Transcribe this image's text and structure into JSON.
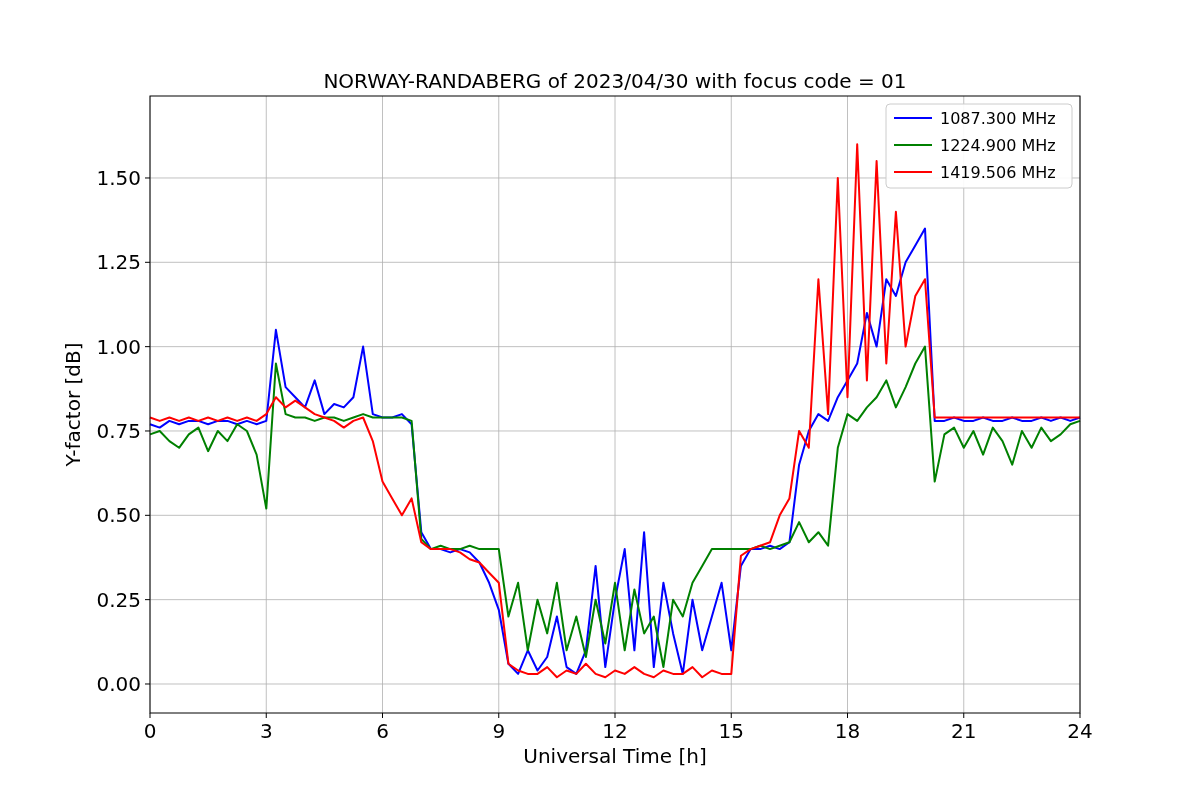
{
  "figure": {
    "chart_data": {
      "type": "line",
      "title": "NORWAY-RANDABERG of 2023/04/30 with focus code = 01",
      "xlabel": "Universal Time [h]",
      "ylabel": "Y-factor [dB]",
      "x": [
        0,
        0.25,
        0.5,
        0.75,
        1,
        1.25,
        1.5,
        1.75,
        2,
        2.25,
        2.5,
        2.75,
        3,
        3.25,
        3.5,
        3.75,
        4,
        4.25,
        4.5,
        4.75,
        5,
        5.25,
        5.5,
        5.75,
        6,
        6.25,
        6.5,
        6.75,
        7,
        7.25,
        7.5,
        7.75,
        8,
        8.25,
        8.5,
        8.75,
        9,
        9.25,
        9.5,
        9.75,
        10,
        10.25,
        10.5,
        10.75,
        11,
        11.25,
        11.5,
        11.75,
        12,
        12.25,
        12.5,
        12.75,
        13,
        13.25,
        13.5,
        13.75,
        14,
        14.25,
        14.5,
        14.75,
        15,
        15.25,
        15.5,
        15.75,
        16,
        16.25,
        16.5,
        16.75,
        17,
        17.25,
        17.5,
        17.75,
        18,
        18.25,
        18.5,
        18.75,
        19,
        19.25,
        19.5,
        19.75,
        20,
        20.25,
        20.5,
        20.75,
        21,
        21.25,
        21.5,
        21.75,
        22,
        22.25,
        22.5,
        22.75,
        23,
        23.25,
        23.5,
        23.75,
        24
      ],
      "series": [
        {
          "name": "1087.300 MHz",
          "color": "#0000ff",
          "values": [
            0.77,
            0.76,
            0.78,
            0.77,
            0.78,
            0.78,
            0.77,
            0.78,
            0.78,
            0.77,
            0.78,
            0.77,
            0.78,
            1.05,
            0.88,
            0.85,
            0.82,
            0.9,
            0.8,
            0.83,
            0.82,
            0.85,
            1.0,
            0.8,
            0.79,
            0.79,
            0.8,
            0.77,
            0.45,
            0.4,
            0.4,
            0.39,
            0.4,
            0.39,
            0.36,
            0.3,
            0.22,
            0.06,
            0.03,
            0.1,
            0.04,
            0.08,
            0.2,
            0.05,
            0.03,
            0.1,
            0.35,
            0.05,
            0.25,
            0.4,
            0.1,
            0.45,
            0.05,
            0.3,
            0.15,
            0.03,
            0.25,
            0.1,
            0.2,
            0.3,
            0.1,
            0.35,
            0.4,
            0.4,
            0.41,
            0.4,
            0.42,
            0.65,
            0.75,
            0.8,
            0.78,
            0.85,
            0.9,
            0.95,
            1.1,
            1.0,
            1.2,
            1.15,
            1.25,
            1.3,
            1.35,
            0.78,
            0.78,
            0.79,
            0.78,
            0.78,
            0.79,
            0.78,
            0.78,
            0.79,
            0.78,
            0.78,
            0.79,
            0.78,
            0.79,
            0.78,
            0.79
          ]
        },
        {
          "name": "1224.900 MHz",
          "color": "#008000",
          "values": [
            0.74,
            0.75,
            0.72,
            0.7,
            0.74,
            0.76,
            0.69,
            0.75,
            0.72,
            0.77,
            0.75,
            0.68,
            0.52,
            0.95,
            0.8,
            0.79,
            0.79,
            0.78,
            0.79,
            0.79,
            0.78,
            0.79,
            0.8,
            0.79,
            0.79,
            0.79,
            0.79,
            0.78,
            0.43,
            0.4,
            0.41,
            0.4,
            0.4,
            0.41,
            0.4,
            0.4,
            0.4,
            0.2,
            0.3,
            0.1,
            0.25,
            0.15,
            0.3,
            0.1,
            0.2,
            0.08,
            0.25,
            0.12,
            0.3,
            0.1,
            0.28,
            0.15,
            0.2,
            0.05,
            0.25,
            0.2,
            0.3,
            0.35,
            0.4,
            0.4,
            0.4,
            0.4,
            0.4,
            0.41,
            0.4,
            0.41,
            0.42,
            0.48,
            0.42,
            0.45,
            0.41,
            0.7,
            0.8,
            0.78,
            0.82,
            0.85,
            0.9,
            0.82,
            0.88,
            0.95,
            1.0,
            0.6,
            0.74,
            0.76,
            0.7,
            0.75,
            0.68,
            0.76,
            0.72,
            0.65,
            0.75,
            0.7,
            0.76,
            0.72,
            0.74,
            0.77,
            0.78
          ]
        },
        {
          "name": "1419.506 MHz",
          "color": "#ff0000",
          "values": [
            0.79,
            0.78,
            0.79,
            0.78,
            0.79,
            0.78,
            0.79,
            0.78,
            0.79,
            0.78,
            0.79,
            0.78,
            0.8,
            0.85,
            0.82,
            0.84,
            0.82,
            0.8,
            0.79,
            0.78,
            0.76,
            0.78,
            0.79,
            0.72,
            0.6,
            0.55,
            0.5,
            0.55,
            0.42,
            0.4,
            0.4,
            0.4,
            0.39,
            0.37,
            0.36,
            0.33,
            0.3,
            0.06,
            0.04,
            0.03,
            0.03,
            0.05,
            0.02,
            0.04,
            0.03,
            0.06,
            0.03,
            0.02,
            0.04,
            0.03,
            0.05,
            0.03,
            0.02,
            0.04,
            0.03,
            0.03,
            0.05,
            0.02,
            0.04,
            0.03,
            0.03,
            0.38,
            0.4,
            0.41,
            0.42,
            0.5,
            0.55,
            0.75,
            0.7,
            1.2,
            0.8,
            1.5,
            0.85,
            1.6,
            0.9,
            1.55,
            0.95,
            1.4,
            1.0,
            1.15,
            1.2,
            0.79,
            0.79,
            0.79,
            0.79,
            0.79,
            0.79,
            0.79,
            0.79,
            0.79,
            0.79,
            0.79,
            0.79,
            0.79,
            0.79,
            0.79,
            0.79
          ]
        }
      ],
      "grid": true,
      "legend": true,
      "xlim": [
        0,
        24
      ],
      "ylim": [
        -0.086,
        1.743
      ],
      "xticks": [
        0,
        3,
        6,
        9,
        12,
        15,
        18,
        21,
        24
      ],
      "yticks": [
        {
          "value": 0,
          "label": "0.00"
        },
        {
          "value": 0.25,
          "label": "0.25"
        },
        {
          "value": 0.5,
          "label": "0.50"
        },
        {
          "value": 0.75,
          "label": "0.75"
        },
        {
          "value": 1,
          "label": "1.00"
        },
        {
          "value": 1.25,
          "label": "1.25"
        },
        {
          "value": 1.5,
          "label": "1.50"
        }
      ]
    }
  }
}
